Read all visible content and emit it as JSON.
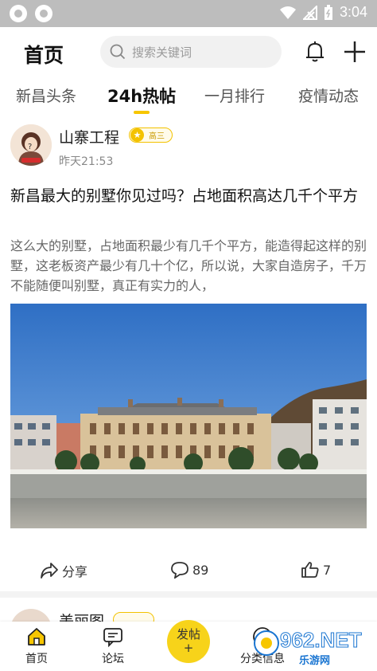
{
  "status_bar": {
    "time": "3:04"
  },
  "header": {
    "title": "首页",
    "search_placeholder": "搜索关键词"
  },
  "tabs": [
    {
      "label": "新昌头条",
      "active": false
    },
    {
      "label": "24h热帖",
      "active": true
    },
    {
      "label": "一月排行",
      "active": false
    },
    {
      "label": "疫情动态",
      "active": false
    }
  ],
  "post": {
    "author": "山寨工程",
    "badge": "高三",
    "time": "昨天21:53",
    "title": "新昌最大的别墅你见过吗？占地面积高达几千个平方",
    "body": "这么大的别墅，占地面积最少有几千个平方，能造得起这样的别墅，这老板资产最少有几十个亿，所以说，大家自造房子，千万不能随便叫别墅，真正有实力的人，",
    "share_label": "分享",
    "comment_count": "89",
    "like_count": "7"
  },
  "next_post": {
    "author": "美丽图"
  },
  "bottom_nav": {
    "home": "首页",
    "forum": "论坛",
    "post_label": "发帖",
    "post_plus": "+",
    "category": "分类信息"
  },
  "watermark": {
    "text": "962.NET",
    "sub": "乐游网"
  },
  "colors": {
    "accent": "#f7c600",
    "status_bar": "#bdbdbd"
  }
}
